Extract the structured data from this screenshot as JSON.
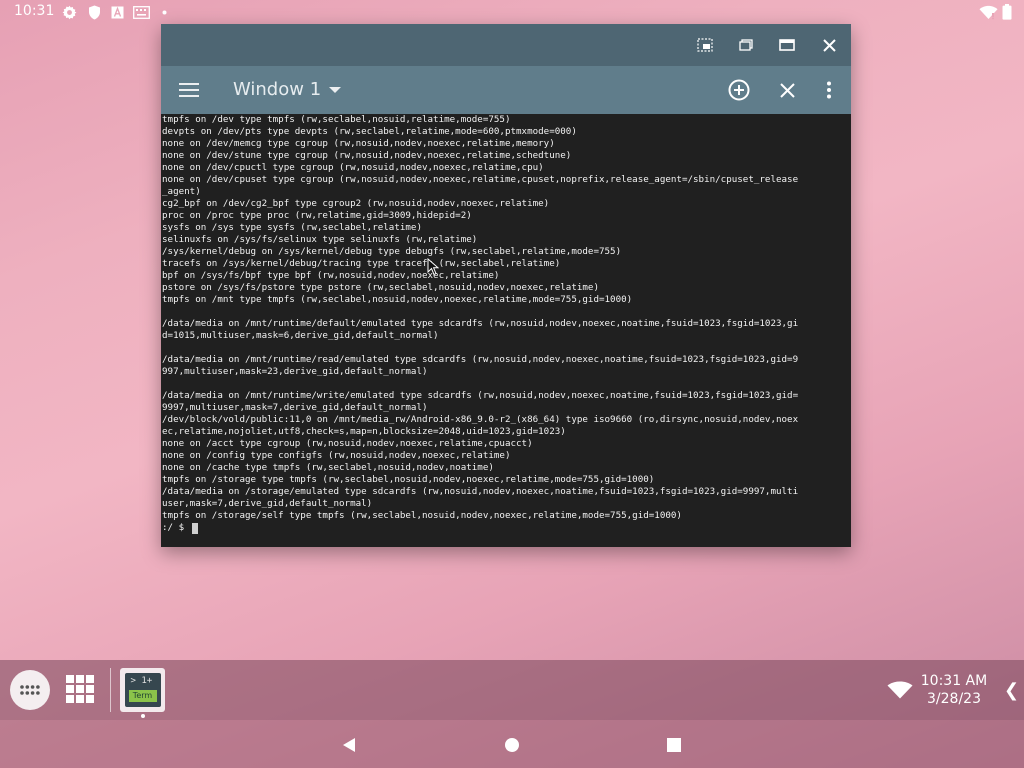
{
  "statusbar": {
    "time": "10:31",
    "icons": [
      "settings-gear-icon",
      "shield-icon",
      "a-font-icon",
      "keyboard-icon",
      "dot-icon"
    ],
    "right_icons": [
      "wifi-warning-icon",
      "battery-icon"
    ]
  },
  "window": {
    "titlebar_buttons": [
      "freeform-window-icon",
      "restore-window-icon",
      "maximize-window-icon",
      "close-window-icon"
    ],
    "title": "Window 1",
    "appbar_buttons": [
      "add-window-icon",
      "close-session-icon",
      "overflow-menu-icon"
    ]
  },
  "terminal": {
    "lines": [
      "tmpfs on /dev type tmpfs (rw,seclabel,nosuid,relatime,mode=755)",
      "devpts on /dev/pts type devpts (rw,seclabel,relatime,mode=600,ptmxmode=000)",
      "none on /dev/memcg type cgroup (rw,nosuid,nodev,noexec,relatime,memory)",
      "none on /dev/stune type cgroup (rw,nosuid,nodev,noexec,relatime,schedtune)",
      "none on /dev/cpuctl type cgroup (rw,nosuid,nodev,noexec,relatime,cpu)",
      "none on /dev/cpuset type cgroup (rw,nosuid,nodev,noexec,relatime,cpuset,noprefix,release_agent=/sbin/cpuset_release",
      "_agent)",
      "cg2_bpf on /dev/cg2_bpf type cgroup2 (rw,nosuid,nodev,noexec,relatime)",
      "proc on /proc type proc (rw,relatime,gid=3009,hidepid=2)",
      "sysfs on /sys type sysfs (rw,seclabel,relatime)",
      "selinuxfs on /sys/fs/selinux type selinuxfs (rw,relatime)",
      "/sys/kernel/debug on /sys/kernel/debug type debugfs (rw,seclabel,relatime,mode=755)",
      "tracefs on /sys/kernel/debug/tracing type tracefs (rw,seclabel,relatime)",
      "bpf on /sys/fs/bpf type bpf (rw,nosuid,nodev,noexec,relatime)",
      "pstore on /sys/fs/pstore type pstore (rw,seclabel,nosuid,nodev,noexec,relatime)",
      "tmpfs on /mnt type tmpfs (rw,seclabel,nosuid,nodev,noexec,relatime,mode=755,gid=1000)",
      "",
      "/data/media on /mnt/runtime/default/emulated type sdcardfs (rw,nosuid,nodev,noexec,noatime,fsuid=1023,fsgid=1023,gi",
      "d=1015,multiuser,mask=6,derive_gid,default_normal)",
      "",
      "/data/media on /mnt/runtime/read/emulated type sdcardfs (rw,nosuid,nodev,noexec,noatime,fsuid=1023,fsgid=1023,gid=9",
      "997,multiuser,mask=23,derive_gid,default_normal)",
      "",
      "/data/media on /mnt/runtime/write/emulated type sdcardfs (rw,nosuid,nodev,noexec,noatime,fsuid=1023,fsgid=1023,gid=",
      "9997,multiuser,mask=7,derive_gid,default_normal)",
      "/dev/block/vold/public:11,0 on /mnt/media_rw/Android-x86_9.0-r2_(x86_64) type iso9660 (ro,dirsync,nosuid,nodev,noex",
      "ec,relatime,nojoliet,utf8,check=s,map=n,blocksize=2048,uid=1023,gid=1023)",
      "none on /acct type cgroup (rw,nosuid,nodev,noexec,relatime,cpuacct)",
      "none on /config type configfs (rw,nosuid,nodev,noexec,relatime)",
      "none on /cache type tmpfs (rw,seclabel,nosuid,nodev,noatime)",
      "tmpfs on /storage type tmpfs (rw,seclabel,nosuid,nodev,noexec,relatime,mode=755,gid=1000)",
      "/data/media on /storage/emulated type sdcardfs (rw,nosuid,nodev,noexec,noatime,fsuid=1023,fsgid=1023,gid=9997,multi",
      "user,mask=7,derive_gid,default_normal)",
      "tmpfs on /storage/self type tmpfs (rw,seclabel,nosuid,nodev,noexec,relatime,mode=755,gid=1000)"
    ],
    "prompt": ":/ $ "
  },
  "taskbar": {
    "apps_icon": "all-apps-icon",
    "grid_icon": "recent-apps-grid-icon",
    "term_app": {
      "line1": "> 1+",
      "line2": "Term"
    },
    "clock_time": "10:31 AM",
    "clock_date": "3/28/23",
    "chevron": "❮"
  },
  "navbar": {
    "buttons": [
      "back-icon",
      "home-icon",
      "overview-icon"
    ]
  }
}
